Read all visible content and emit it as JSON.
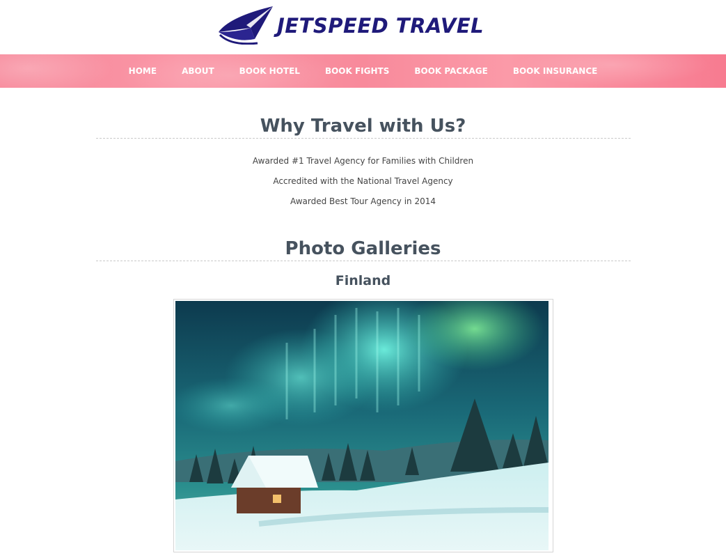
{
  "brand": {
    "name": "JETSPEED TRAVEL",
    "logo_icon": "paper-plane-icon",
    "color": "#1f1a7a"
  },
  "nav": {
    "items": [
      {
        "label": "HOME"
      },
      {
        "label": "ABOUT"
      },
      {
        "label": "BOOK HOTEL"
      },
      {
        "label": "BOOK FIGHTS"
      },
      {
        "label": "BOOK PACKAGE"
      },
      {
        "label": "BOOK INSURANCE"
      }
    ],
    "background": "#f7889a"
  },
  "why": {
    "title": "Why Travel with Us?",
    "reasons": [
      "Awarded #1 Travel Agency for Families with Children",
      "Accredited with the National Travel Agency",
      "Awarded Best Tour Agency in 2014"
    ]
  },
  "gallery": {
    "title": "Photo Galleries",
    "country": "Finland",
    "photo_subject": "northern-lights-snowy-cabin"
  },
  "colors": {
    "heading": "#46525e",
    "text": "#444444"
  }
}
